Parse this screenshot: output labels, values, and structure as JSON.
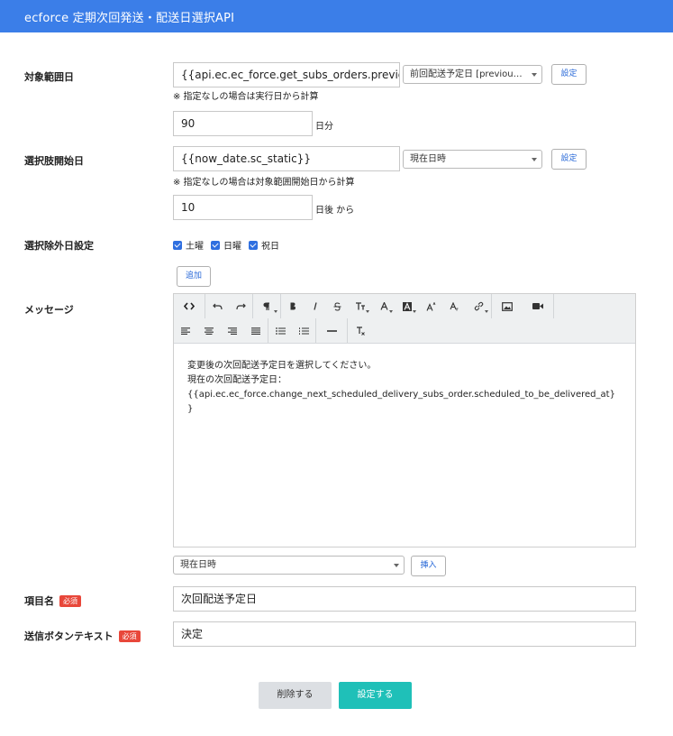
{
  "header": {
    "title": "ecforce 定期次回発送・配送日選択API"
  },
  "range": {
    "label": "対象範囲日",
    "value": "{{api.ec.ec_force.get_subs_orders.previous_",
    "select": "前回配送予定日 [previou…",
    "set_button": "設定",
    "note": "※ 指定なしの場合は実行日から計算",
    "days_value": "90",
    "days_unit": "日分"
  },
  "choice_start": {
    "label": "選択肢開始日",
    "value": "{{now_date.sc_static}}",
    "select": "現在日時",
    "set_button": "設定",
    "note": "※ 指定なしの場合は対象範囲開始日から計算",
    "days_value": "10",
    "days_unit": "日後 から"
  },
  "exclude": {
    "label": "選択除外日設定",
    "options": [
      {
        "label": "土曜",
        "checked": true
      },
      {
        "label": "日曜",
        "checked": true
      },
      {
        "label": "祝日",
        "checked": true
      }
    ],
    "add_button": "追加"
  },
  "message": {
    "label": "メッセージ",
    "toolbar_icons": [
      "code-view-icon",
      "undo-icon",
      "redo-icon",
      "paragraph-icon",
      "bold-icon",
      "italic-icon",
      "strikethrough-icon",
      "font-size-icon",
      "font-color-icon",
      "background-color-icon",
      "superscript-icon",
      "subscript-icon",
      "link-icon",
      "image-icon",
      "video-icon",
      "align-left-icon",
      "align-center-icon",
      "align-right-icon",
      "align-justify-icon",
      "bullet-list-icon",
      "numbered-list-icon",
      "horizontal-rule-icon",
      "clear-format-icon"
    ],
    "body_line1": "変更後の次回配送予定日を選択してください。",
    "body_line2": "現在の次回配送予定日：",
    "body_line3": "{{api.ec.ec_force.change_next_scheduled_delivery_subs_order.scheduled_to_be_delivered_at}",
    "body_line4": "}",
    "insert_select": "現在日時",
    "insert_button": "挿入"
  },
  "item_name": {
    "label": "項目名",
    "required": "必須",
    "value": "次回配送予定日"
  },
  "submit_text": {
    "label": "送信ボタンテキスト",
    "required": "必須",
    "value": "決定"
  },
  "footer": {
    "delete_button": "削除する",
    "save_button": "設定する"
  },
  "colors": {
    "header": "#3b7ee8",
    "primary": "#1fc0b8",
    "required_badge": "#e8473a",
    "link": "#2a6ad8"
  }
}
